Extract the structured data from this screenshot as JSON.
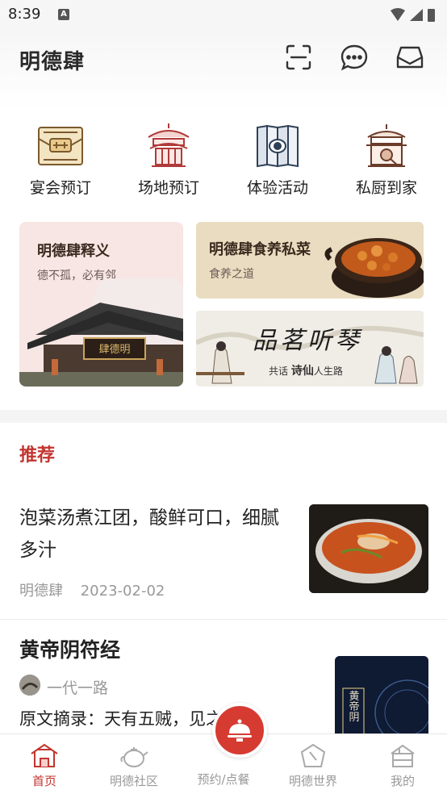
{
  "status": {
    "time": "8:39",
    "notification_glyph": "A"
  },
  "header": {
    "title": "明德肆",
    "icons": [
      "scan-icon",
      "message-icon",
      "inbox-icon"
    ]
  },
  "quick_actions": [
    {
      "label": "宴会预订",
      "icon": "banquet-icon"
    },
    {
      "label": "场地预订",
      "icon": "pavilion-icon"
    },
    {
      "label": "体验活动",
      "icon": "screen-icon"
    },
    {
      "label": "私厨到家",
      "icon": "house-icon"
    }
  ],
  "cards": {
    "big": {
      "title": "明德肆释义",
      "subtitle": "德不孤，必有邻",
      "plaque": "肆德明"
    },
    "food": {
      "title": "明德肆食养私菜",
      "subtitle": "食养之道"
    },
    "tea": {
      "title": "品茗听琴",
      "subtitle_prefix": "共话",
      "subtitle_strong": "诗仙",
      "subtitle_suffix": "人生路"
    }
  },
  "recommend": {
    "section_title": "推荐",
    "articles": [
      {
        "title": "泡菜汤煮江团，酸鲜可口，细腻多汁",
        "source": "明德肆",
        "date": "2023-02-02"
      },
      {
        "title": "黄帝阴符经",
        "author": "一代一路",
        "excerpt": "原文摘录：天有五贼，见之者昌。",
        "image_text": "黄帝阴"
      }
    ]
  },
  "tabbar": {
    "tabs": [
      {
        "label": "首页",
        "active": true
      },
      {
        "label": "明德社区",
        "active": false
      },
      {
        "label": "预约/点餐",
        "active": false
      },
      {
        "label": "明德世界",
        "active": false
      },
      {
        "label": "我的",
        "active": false
      }
    ]
  },
  "colors": {
    "accent": "#c2352f",
    "brown": "#8a6a3a",
    "navy": "#2f4058"
  }
}
